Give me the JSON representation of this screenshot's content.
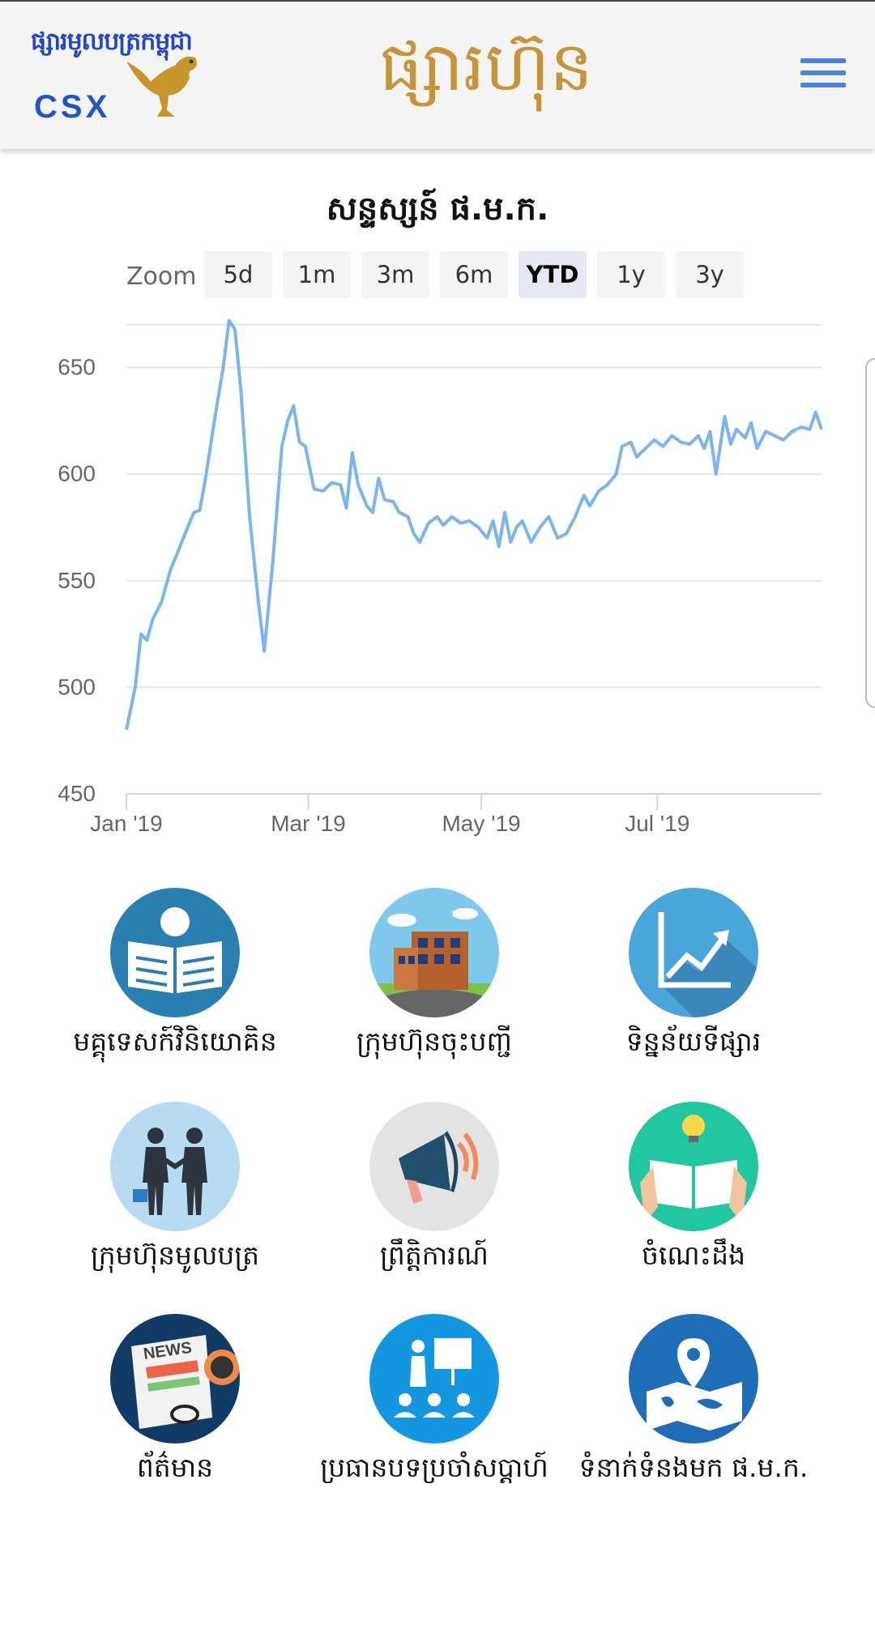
{
  "header": {
    "logo_khmer": "ផ្សារមូលបត្រកម្ពុជា",
    "logo_text": "CSX",
    "app_title": "ផ្សារហ៊ុន",
    "menu_icon": "hamburger-menu-icon"
  },
  "chart": {
    "title": "សន្ទស្សន៍ ផ.ម.ក.",
    "zoom_label": "Zoom",
    "zoom_options": [
      "5d",
      "1m",
      "3m",
      "6m",
      "YTD",
      "1y",
      "3y"
    ],
    "selected_zoom": "YTD"
  },
  "chart_data": {
    "type": "line",
    "title": "សន្ទស្សន៍ ផ.ម.ក.",
    "xlabel": "",
    "ylabel": "",
    "ylim": [
      450,
      670
    ],
    "yticks": [
      450,
      500,
      550,
      600,
      650
    ],
    "x_tick_labels": [
      "Jan '19",
      "Mar '19",
      "May '19",
      "Jul '19"
    ],
    "x_tick_dates": [
      "2019-01-01",
      "2019-03-04",
      "2019-05-02",
      "2019-07-01"
    ],
    "grid": true,
    "line_color": "#7cb5ec",
    "series": [
      {
        "points": [
          [
            "2019-01-01",
            480
          ],
          [
            "2019-01-04",
            500
          ],
          [
            "2019-01-06",
            525
          ],
          [
            "2019-01-08",
            522
          ],
          [
            "2019-01-10",
            532
          ],
          [
            "2019-01-13",
            540
          ],
          [
            "2019-01-16",
            555
          ],
          [
            "2019-01-19",
            565
          ],
          [
            "2019-01-21",
            572
          ],
          [
            "2019-01-24",
            582
          ],
          [
            "2019-01-26",
            583
          ],
          [
            "2019-01-28",
            598
          ],
          [
            "2019-01-31",
            625
          ],
          [
            "2019-02-03",
            650
          ],
          [
            "2019-02-05",
            672
          ],
          [
            "2019-02-07",
            668
          ],
          [
            "2019-02-09",
            640
          ],
          [
            "2019-02-12",
            580
          ],
          [
            "2019-02-15",
            540
          ],
          [
            "2019-02-17",
            517
          ],
          [
            "2019-02-20",
            560
          ],
          [
            "2019-02-23",
            613
          ],
          [
            "2019-02-25",
            625
          ],
          [
            "2019-02-27",
            632
          ],
          [
            "2019-03-01",
            615
          ],
          [
            "2019-03-03",
            613
          ],
          [
            "2019-03-06",
            593
          ],
          [
            "2019-03-09",
            592
          ],
          [
            "2019-03-12",
            596
          ],
          [
            "2019-03-15",
            595
          ],
          [
            "2019-03-17",
            584
          ],
          [
            "2019-03-19",
            610
          ],
          [
            "2019-03-21",
            595
          ],
          [
            "2019-03-24",
            585
          ],
          [
            "2019-03-26",
            582
          ],
          [
            "2019-03-28",
            598
          ],
          [
            "2019-03-30",
            588
          ],
          [
            "2019-04-02",
            587
          ],
          [
            "2019-04-04",
            582
          ],
          [
            "2019-04-07",
            580
          ],
          [
            "2019-04-09",
            572
          ],
          [
            "2019-04-11",
            568
          ],
          [
            "2019-04-14",
            577
          ],
          [
            "2019-04-17",
            580
          ],
          [
            "2019-04-19",
            576
          ],
          [
            "2019-04-22",
            580
          ],
          [
            "2019-04-25",
            577
          ],
          [
            "2019-04-28",
            578
          ],
          [
            "2019-05-01",
            575
          ],
          [
            "2019-05-04",
            570
          ],
          [
            "2019-05-06",
            578
          ],
          [
            "2019-05-08",
            566
          ],
          [
            "2019-05-10",
            582
          ],
          [
            "2019-05-12",
            568
          ],
          [
            "2019-05-14",
            575
          ],
          [
            "2019-05-16",
            578
          ],
          [
            "2019-05-19",
            568
          ],
          [
            "2019-05-22",
            575
          ],
          [
            "2019-05-25",
            580
          ],
          [
            "2019-05-28",
            570
          ],
          [
            "2019-05-31",
            572
          ],
          [
            "2019-06-03",
            580
          ],
          [
            "2019-06-06",
            590
          ],
          [
            "2019-06-08",
            585
          ],
          [
            "2019-06-11",
            592
          ],
          [
            "2019-06-14",
            595
          ],
          [
            "2019-06-17",
            600
          ],
          [
            "2019-06-19",
            613
          ],
          [
            "2019-06-22",
            615
          ],
          [
            "2019-06-24",
            608
          ],
          [
            "2019-06-27",
            612
          ],
          [
            "2019-06-30",
            616
          ],
          [
            "2019-07-03",
            613
          ],
          [
            "2019-07-06",
            618
          ],
          [
            "2019-07-09",
            615
          ],
          [
            "2019-07-12",
            614
          ],
          [
            "2019-07-15",
            618
          ],
          [
            "2019-07-17",
            612
          ],
          [
            "2019-07-19",
            620
          ],
          [
            "2019-07-21",
            600
          ],
          [
            "2019-07-24",
            627
          ],
          [
            "2019-07-26",
            614
          ],
          [
            "2019-07-28",
            621
          ],
          [
            "2019-07-31",
            617
          ],
          [
            "2019-08-02",
            624
          ],
          [
            "2019-08-04",
            612
          ],
          [
            "2019-08-07",
            620
          ],
          [
            "2019-08-10",
            618
          ],
          [
            "2019-08-13",
            616
          ],
          [
            "2019-08-16",
            620
          ],
          [
            "2019-08-19",
            622
          ],
          [
            "2019-08-22",
            621
          ],
          [
            "2019-08-24",
            629
          ],
          [
            "2019-08-26",
            621
          ]
        ]
      }
    ]
  },
  "menu": [
    {
      "label": "មគ្គុទេសក៍វិនិយោគិន",
      "icon": "newspaper-reader-icon",
      "color": "#2a7fb0"
    },
    {
      "label": "ក្រុមហ៊ុនចុះបញ្ជី",
      "icon": "company-building-icon",
      "color": "#7ec9ec"
    },
    {
      "label": "ទិន្នន័យទីផ្សារ",
      "icon": "market-chart-icon",
      "color": "#4aa6d8"
    },
    {
      "label": "ក្រុមហ៊ុនមូលបត្រ",
      "icon": "handshake-people-icon",
      "color": "#b9dbf2"
    },
    {
      "label": "ព្រឹត្តិការណ៍",
      "icon": "megaphone-icon",
      "color": "#e3e3e3"
    },
    {
      "label": "ចំណេះដឹង",
      "icon": "book-idea-icon",
      "color": "#22c6a0"
    },
    {
      "label": "ព័ត៌មាន",
      "icon": "news-icon",
      "color": "#123a66"
    },
    {
      "label": "ប្រធានបទប្រចាំសប្តាហ៍",
      "icon": "presentation-icon",
      "color": "#1596e0"
    },
    {
      "label": "ទំនាក់ទំនងមក ផ.ម.ក.",
      "icon": "map-location-icon",
      "color": "#1e6db6"
    }
  ]
}
